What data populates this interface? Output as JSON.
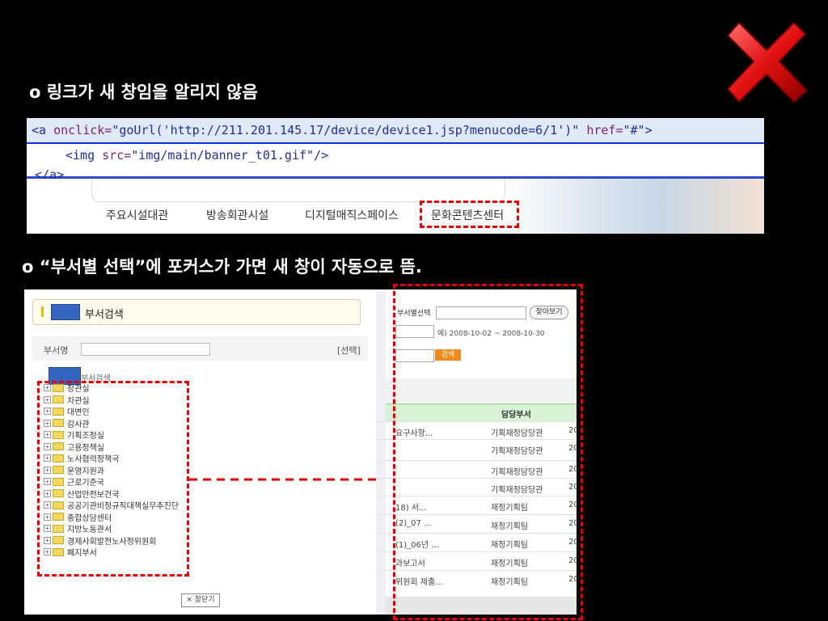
{
  "heading1": "o 링크가 새 창임을 알리지 않음",
  "heading2": "o “부서별 선택”에 포커스가 가면 새 창이 자동으로 뜸.",
  "code": {
    "line1_tag_open": "<a ",
    "line1_attr1": "onclick=",
    "line1_val1": "\"goUrl('http://211.201.145.17/device/device1.jsp?menucode=6/1')\"",
    "line1_attr2": " href=",
    "line1_val2": "\"#\"",
    "line1_tag_close": ">",
    "line2_tag_open": "<img ",
    "line2_attr": "src=",
    "line2_val": "\"img/main/banner_t01.gif\"",
    "line2_tag_close": "/>",
    "line3": "</a>"
  },
  "menu": {
    "items": [
      "주요시설대관",
      "방송회관시설",
      "디지털매직스페이스",
      "문화콘텐츠센터"
    ]
  },
  "left_panel": {
    "title": "부서검색",
    "dept_label": "부서명",
    "select_link": "[선택]",
    "tree_root": "부서검색",
    "tree_items": [
      "장관실",
      "차관실",
      "대변인",
      "감사관",
      "기획조정실",
      "고용정책실",
      "노사협력정책국",
      "운영지원과",
      "근로기준국",
      "산업안전보건국",
      "공공기관비정규직대책실무추진단",
      "종합상담센터",
      "지방노동관서",
      "경제사회발전노사정위원회",
      "폐지부서"
    ],
    "close_button": "× 창닫기"
  },
  "right_panel": {
    "dept_select_label": "부서별선택",
    "find_button": "찾아보기",
    "date_hint": "예) 2008-10-02 ~ 2008-10-30",
    "search_button": "검색",
    "column_header": "담당부서",
    "rows": [
      {
        "title": "요구사항...",
        "dept": "기획재정담당관",
        "date": "20"
      },
      {
        "title": "",
        "dept": "기획재정담당관",
        "date": "20"
      },
      {
        "title": "",
        "dept": "기획재정담당관",
        "date": "20"
      },
      {
        "title": "",
        "dept": "기획재정담당관",
        "date": "20"
      },
      {
        "title": "18) 서...",
        "dept": "재정기획팀",
        "date": "20"
      },
      {
        "title": "(2)_07 ...",
        "dept": "재정기획팀",
        "date": "20"
      },
      {
        "title": "(1)_06년 ...",
        "dept": "재정기획팀",
        "date": "20"
      },
      {
        "title": "과보고서",
        "dept": "재정기획팀",
        "date": "20"
      },
      {
        "title": "위원회 제출...",
        "dept": "재정기획팀",
        "date": "20"
      }
    ]
  },
  "colors": {
    "highlight_red": "#e00000",
    "header_green": "#d9f2d6",
    "selection_blue": "#0b2fd6"
  }
}
